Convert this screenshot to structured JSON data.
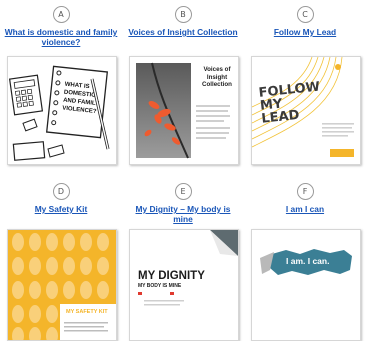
{
  "resources": [
    {
      "letter": "A",
      "title": "What is domestic and family violence?",
      "thumb_text": "WHAT IS DOMESTIC AND FAMILY VIOLENCE?"
    },
    {
      "letter": "B",
      "title": "Voices of Insight Collection",
      "thumb_text": "Voices of Insight Collection"
    },
    {
      "letter": "C",
      "title": "Follow My Lead",
      "thumb_text": "FOLLOW MY LEAD"
    },
    {
      "letter": "D",
      "title": "My Safety Kit",
      "thumb_text": "MY SAFETY KIT"
    },
    {
      "letter": "E",
      "title": "My Dignity – My body is mine",
      "thumb_text": "MY DIGNITY",
      "thumb_subtext": "MY BODY IS MINE"
    },
    {
      "letter": "F",
      "title": "I am I can",
      "thumb_text": "I am. I can."
    }
  ],
  "colors": {
    "link": "#1a56b8",
    "yellow": "#f4b52a",
    "red_accent": "#e03a2f",
    "teal": "#3b7f95"
  }
}
